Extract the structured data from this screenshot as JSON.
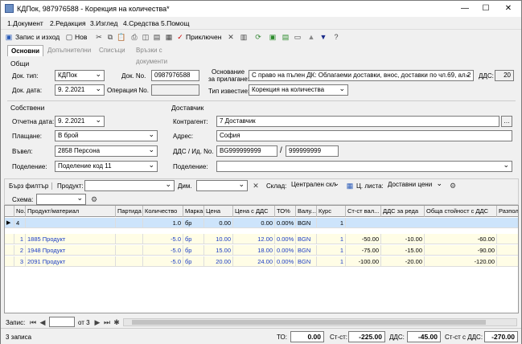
{
  "title": "КДПок, 987976588 - Корекция на количества*",
  "menu": [
    "1.Документ",
    "2.Редакция",
    "3.Изглед",
    "4.Средства",
    "5.Помощ"
  ],
  "toolbar": {
    "save_close": "Запис и изход",
    "new": "Нов",
    "post": "Приключен"
  },
  "tabs": [
    "Основни",
    "Допълнителни",
    "Списъци",
    "Връзки с документи"
  ],
  "general": {
    "section": "Общи",
    "doc_type_label": "Док. тип:",
    "doc_type": "КДПок",
    "doc_no_label": "Док. No.",
    "doc_no": "0987976588",
    "doc_date_label": "Док. дата:",
    "doc_date": "9. 2.2021",
    "op_no_label": "Операция No.",
    "op_no": "",
    "basis_label1": "Основание",
    "basis_label2": "за прилагане:",
    "basis": "С право на пълен ДК: Облагаеми доставки, внос, доставки по чл.69, ал.2",
    "vat_label": "ДДС:",
    "vat": "20",
    "notice_label": "Тип известие:",
    "notice": "Корекция на количества"
  },
  "own": {
    "section": "Собствени",
    "report_date_label": "Отчетна дата:",
    "report_date": "9. 2.2021",
    "payment_label": "Плащане:",
    "payment": "В брой",
    "entered_label": "Въвел:",
    "entered": "2858 Персона",
    "division_label": "Поделение:",
    "division": "Поделение код 11"
  },
  "supplier": {
    "section": "Доставчик",
    "contragent_label": "Контрагент:",
    "contragent": "7 Доставчик",
    "address_label": "Адрес:",
    "address": "София",
    "vat_id_label": "ДДС / Ид. No.",
    "vat_no": "BG999999999",
    "id_no": "999999999",
    "division_label": "Поделение:",
    "division": ""
  },
  "filter": {
    "quick": "Бърз филтър",
    "product_label": "Продукт:",
    "dim_label": "Дим.",
    "store_label": "Склад:",
    "store": "Централен скл",
    "price_list_label": "Ц. листа:",
    "price_list": "Доставни цени",
    "scheme_label": "Схема:"
  },
  "columns": [
    "No.",
    "Продукт/материал",
    "Партида",
    "Количество",
    "Марка",
    "Цена",
    "Цена с ДДС",
    "ТО%",
    "Валу...",
    "Курс",
    "Ст-ст вал...",
    "ДДС за реда",
    "Обща стойност с ДДС",
    "Разпола"
  ],
  "new_row": {
    "no": "4",
    "qty": "1.0",
    "unit": "бр",
    "price": "0.00",
    "price_vat": "0.00",
    "to": "0.00%",
    "cur": "BGN",
    "rate": "1"
  },
  "rows": [
    {
      "no": "1",
      "product": "1885 Продукт",
      "qty": "-5.0",
      "unit": "бр",
      "price": "10.00",
      "price_vat": "12.00",
      "to": "0.00%",
      "cur": "BGN",
      "rate": "1",
      "cost": "-50.00",
      "vat": "-10.00",
      "total": "-60.00"
    },
    {
      "no": "2",
      "product": "1948 Продукт",
      "qty": "-5.0",
      "unit": "бр",
      "price": "15.00",
      "price_vat": "18.00",
      "to": "0.00%",
      "cur": "BGN",
      "rate": "1",
      "cost": "-75.00",
      "vat": "-15.00",
      "total": "-90.00"
    },
    {
      "no": "3",
      "product": "2091 Продукт",
      "qty": "-5.0",
      "unit": "бр",
      "price": "20.00",
      "price_vat": "24.00",
      "to": "0.00%",
      "cur": "BGN",
      "rate": "1",
      "cost": "-100.00",
      "vat": "-20.00",
      "total": "-120.00"
    }
  ],
  "nav": {
    "record_label": "Запис:",
    "of": "от 3"
  },
  "status": {
    "count": "3 записа",
    "to_label": "ТО:",
    "to": "0.00",
    "cost_label": "Ст-ст:",
    "cost": "-225.00",
    "vat_label": "ДДС:",
    "vat": "-45.00",
    "cost_vat_label": "Ст-ст с ДДС:",
    "cost_vat": "-270.00"
  }
}
